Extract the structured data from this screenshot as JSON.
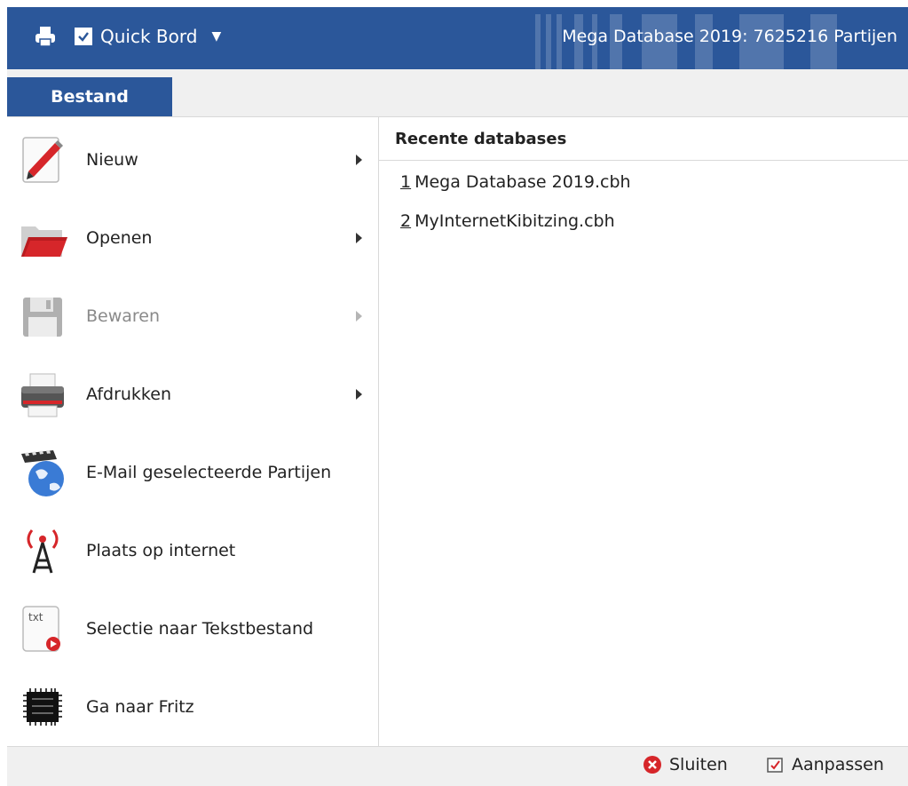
{
  "titlebar": {
    "quick_board_label": "Quick Bord",
    "quick_board_checked": true,
    "title": "Mega Database 2019:  7625216 Partijen"
  },
  "ribbon": {
    "file_tab": "Bestand"
  },
  "menu": {
    "items": [
      {
        "label": "Nieuw",
        "icon": "new-pencil-icon",
        "has_submenu": true,
        "enabled": true
      },
      {
        "label": "Openen",
        "icon": "open-folder-icon",
        "has_submenu": true,
        "enabled": true
      },
      {
        "label": "Bewaren",
        "icon": "save-disk-icon",
        "has_submenu": true,
        "enabled": false
      },
      {
        "label": "Afdrukken",
        "icon": "printer-icon",
        "has_submenu": true,
        "enabled": true
      },
      {
        "label": "E-Mail geselecteerde Partijen",
        "icon": "globe-chessboard-icon",
        "has_submenu": false,
        "enabled": true
      },
      {
        "label": "Plaats op internet",
        "icon": "antenna-icon",
        "has_submenu": false,
        "enabled": true
      },
      {
        "label": "Selectie naar Tekstbestand",
        "icon": "txt-file-icon",
        "has_submenu": false,
        "enabled": true
      },
      {
        "label": "Ga naar Fritz",
        "icon": "chip-icon",
        "has_submenu": false,
        "enabled": true
      }
    ]
  },
  "recent": {
    "heading": "Recente databases",
    "items": [
      {
        "num": "1",
        "name": "Mega Database 2019.cbh"
      },
      {
        "num": "2",
        "name": "MyInternetKibitzing.cbh"
      }
    ]
  },
  "statusbar": {
    "close_label": "Sluiten",
    "customize_label": "Aanpassen"
  },
  "colors": {
    "accent": "#2b579a",
    "danger": "#d6262a"
  }
}
